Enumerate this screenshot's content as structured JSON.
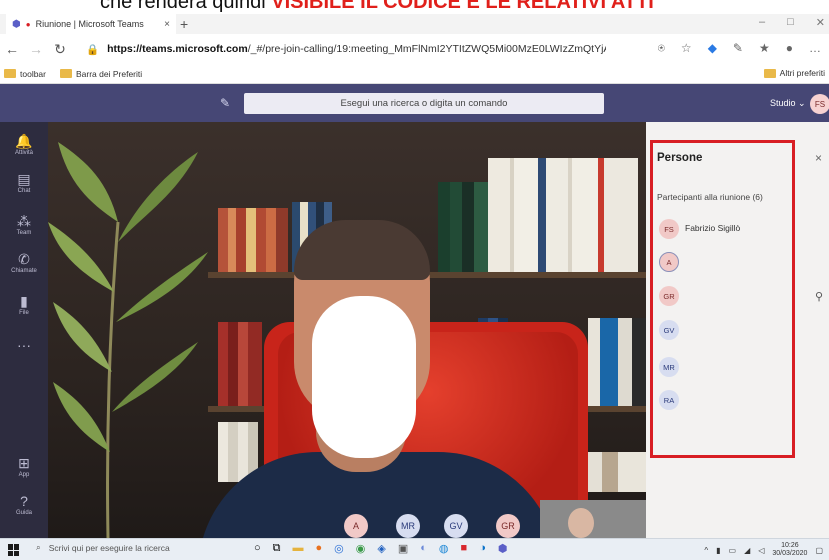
{
  "caption": {
    "prefix": "che renderà quindi ",
    "strong": "VISIBILE IL CODICE E LE RELATIVI ATTI"
  },
  "browser": {
    "tab_title": "Riunione | Microsoft Teams",
    "tab_close": "×",
    "new_tab": "+",
    "url_host": "https://teams.microsoft.com",
    "url_path": "/_#/pre-join-calling/19:meeting_MmFlNmI2YTItZWQ5Mi00MzE0LWIzZmQtYjAxNDQxNW...",
    "favorites": [
      "toolbar",
      "Barra dei Preferiti"
    ],
    "favorites_right": "Altri preferiti",
    "window_controls": [
      "–",
      "□",
      "✕"
    ]
  },
  "teams": {
    "search_placeholder": "Esegui una ricerca o digita un comando",
    "org_label": "Studio ⌄",
    "user_initials": "FS",
    "rail": [
      {
        "icon": "bell-icon",
        "glyph": "🔔",
        "label": "Attività"
      },
      {
        "icon": "chat-icon",
        "glyph": "▤",
        "label": "Chat"
      },
      {
        "icon": "teams-icon",
        "glyph": "⁂",
        "label": "Team"
      },
      {
        "icon": "phone-icon",
        "glyph": "✆",
        "label": "Chiamate"
      },
      {
        "icon": "file-icon",
        "glyph": "▮",
        "label": "File"
      },
      {
        "icon": "more-icon",
        "glyph": "···",
        "label": ""
      },
      {
        "icon": "apps-icon",
        "glyph": "⊞",
        "label": "App"
      },
      {
        "icon": "help-icon",
        "glyph": "?",
        "label": "Guida"
      }
    ]
  },
  "video": {
    "bottom_avatars": [
      "A",
      "MR",
      "GV",
      "GR"
    ]
  },
  "people_panel": {
    "title": "Persone",
    "close": "×",
    "subtitle": "Partecipanti alla riunione (6)",
    "participants": [
      {
        "initials": "FS",
        "name": "Fabrizio Sigillò",
        "color": "#f1c9c7",
        "text": "#7a2a2a"
      },
      {
        "initials": "A",
        "name": "",
        "color": "#f1c9c7",
        "text": "#7a2a2a"
      },
      {
        "initials": "GR",
        "name": "",
        "color": "#f1c9c7",
        "text": "#7a2a2a"
      },
      {
        "initials": "GV",
        "name": "",
        "color": "#d7ddf0",
        "text": "#2a3a7a"
      },
      {
        "initials": "MR",
        "name": "",
        "color": "#d7ddf0",
        "text": "#2a3a7a"
      },
      {
        "initials": "RA",
        "name": "",
        "color": "#d7ddf0",
        "text": "#2a3a7a"
      }
    ]
  },
  "taskbar": {
    "search_placeholder": "Scrivi qui per eseguire la ricerca",
    "time": "10:26",
    "date": "30/03/2020"
  }
}
